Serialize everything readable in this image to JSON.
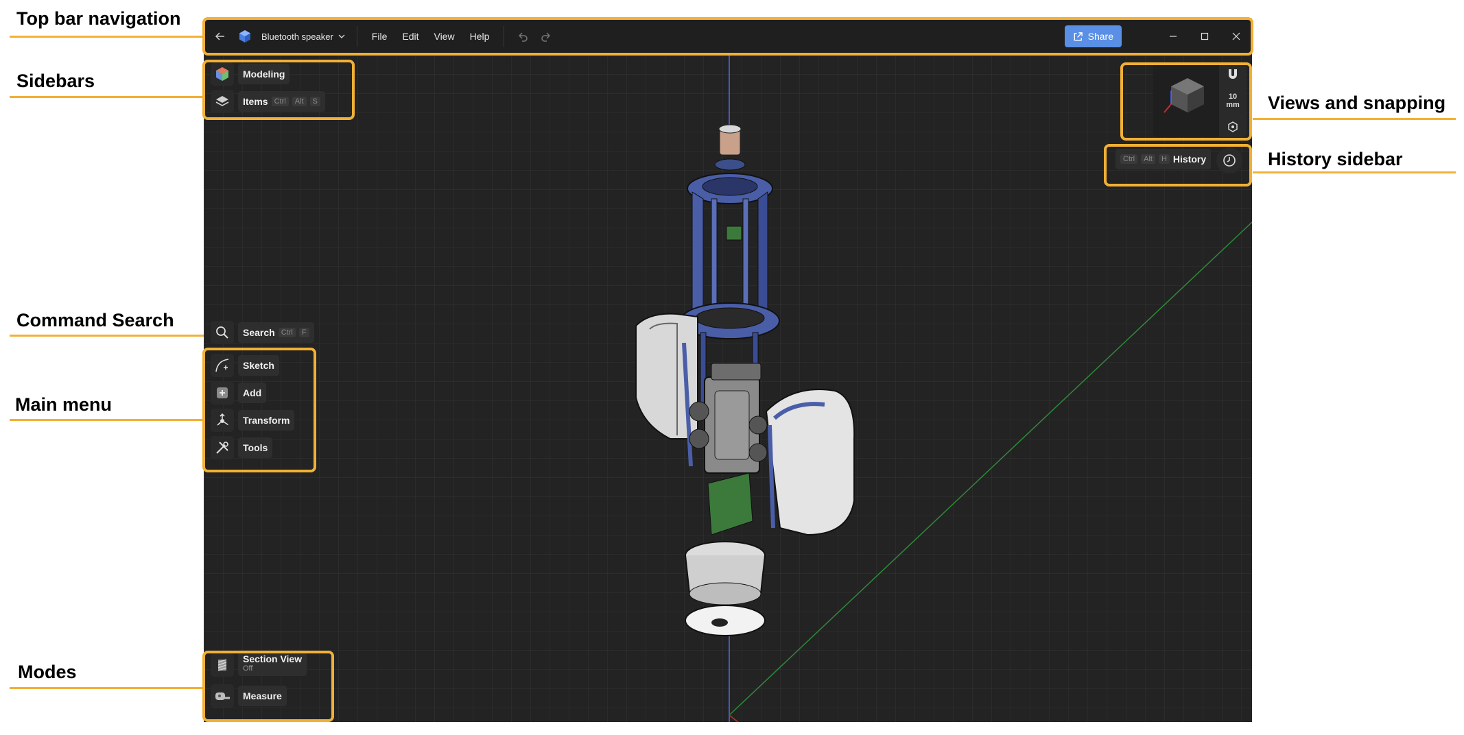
{
  "annotations": {
    "top_bar": "Top bar navigation",
    "sidebars": "Sidebars",
    "command_search": "Command Search",
    "main_menu": "Main menu",
    "modes": "Modes",
    "views_snapping": "Views and snapping",
    "history_sidebar": "History sidebar",
    "accent_color": "#F2B035"
  },
  "topbar": {
    "doc_name": "Bluetooth speaker",
    "menus": [
      "File",
      "Edit",
      "View",
      "Help"
    ],
    "share_label": "Share",
    "share_color": "#5A8FE6",
    "icons": [
      "back-arrow-icon",
      "app-logo-icon",
      "chevron-down-icon",
      "undo-icon",
      "redo-icon",
      "share-icon",
      "minimize-icon",
      "maximize-icon",
      "close-icon"
    ]
  },
  "sidebars": {
    "modeling": "Modeling",
    "items": "Items",
    "items_keys": [
      "Ctrl",
      "Alt",
      "S"
    ]
  },
  "search": {
    "label": "Search",
    "keys": [
      "Ctrl",
      "F"
    ]
  },
  "main_menu": {
    "sketch": "Sketch",
    "add": "Add",
    "transform": "Transform",
    "tools": "Tools"
  },
  "modes": {
    "section_view": "Section View",
    "section_view_state": "Off",
    "measure": "Measure"
  },
  "views": {
    "snap_value": "10",
    "snap_unit": "mm"
  },
  "history": {
    "label": "History",
    "keys": [
      "Ctrl",
      "Alt",
      "H"
    ]
  }
}
